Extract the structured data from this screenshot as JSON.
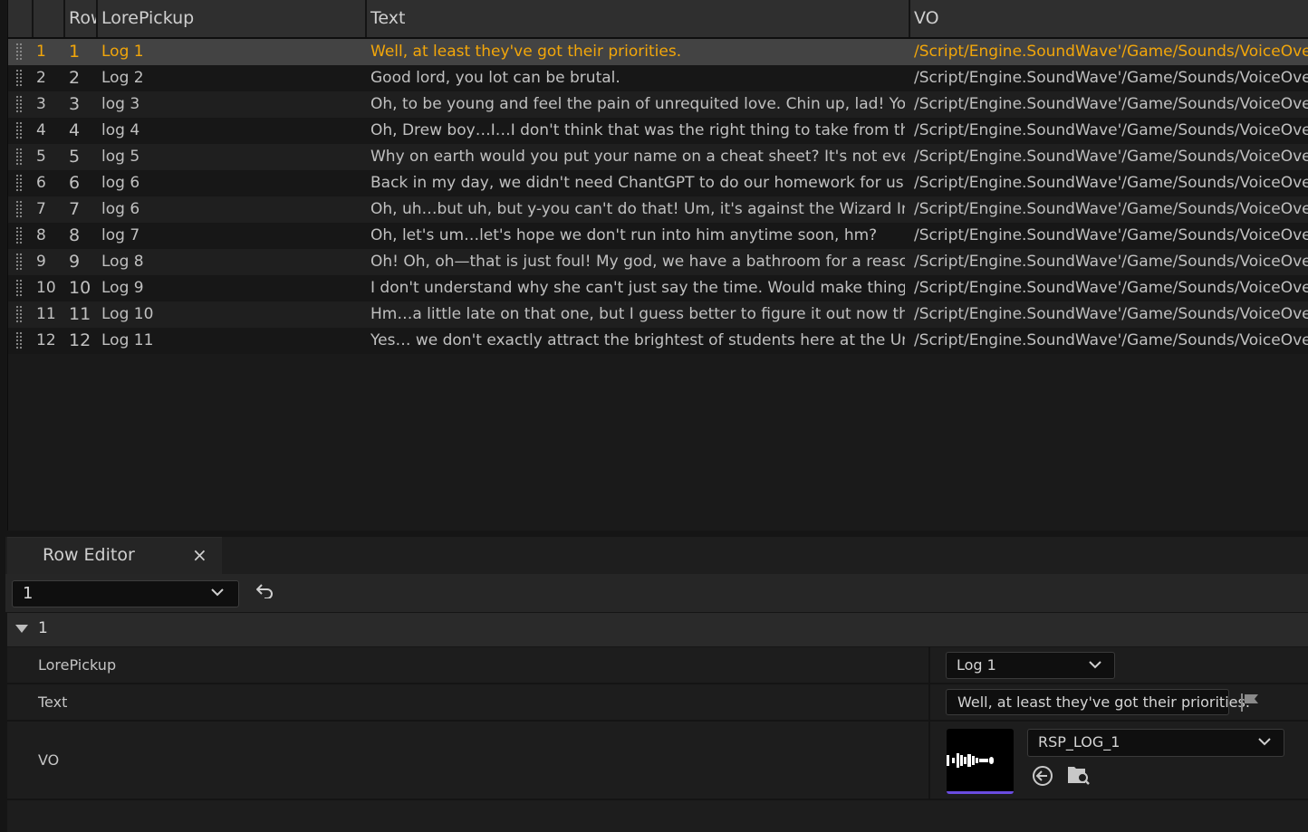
{
  "table": {
    "columns": [
      {
        "label": ""
      },
      {
        "label": "Row Name"
      },
      {
        "label": "LorePickup"
      },
      {
        "label": "Text"
      },
      {
        "label": "VO"
      }
    ],
    "rows": [
      {
        "index": "1",
        "row_name": "1",
        "lore_pickup": "Log 1",
        "text": "Well, at least they've got their priorities.",
        "vo": "/Script/Engine.SoundWave'/Game/Sounds/VoiceOverC"
      },
      {
        "index": "2",
        "row_name": "2",
        "lore_pickup": "Log 2",
        "text": "Good lord, you lot can be brutal.",
        "vo": "/Script/Engine.SoundWave'/Game/Sounds/VoiceOverC"
      },
      {
        "index": "3",
        "row_name": "3",
        "lore_pickup": "log 3",
        "text": "Oh, to be young and feel the pain of unrequited love. Chin up, lad! You'll get",
        "vo": "/Script/Engine.SoundWave'/Game/Sounds/VoiceOverC"
      },
      {
        "index": "4",
        "row_name": "4",
        "lore_pickup": "log 4",
        "text": "Oh, Drew boy…I…I don't think that was the right thing to take from that note",
        "vo": "/Script/Engine.SoundWave'/Game/Sounds/VoiceOverC"
      },
      {
        "index": "5",
        "row_name": "5",
        "lore_pickup": "log 5",
        "text": "Why on earth would you put your name on a cheat sheet? It's not even a go",
        "vo": "/Script/Engine.SoundWave'/Game/Sounds/VoiceOverC"
      },
      {
        "index": "6",
        "row_name": "6",
        "lore_pickup": "log 6",
        "text": "Back in my day, we didn't need ChantGPT to do our homework for us! We'd",
        "vo": "/Script/Engine.SoundWave'/Game/Sounds/VoiceOverC"
      },
      {
        "index": "7",
        "row_name": "7",
        "lore_pickup": "log 6",
        "text": "Oh, uh…but uh, but y-you can't do that! Um, it's against the Wizard Integrity",
        "vo": "/Script/Engine.SoundWave'/Game/Sounds/VoiceOverC"
      },
      {
        "index": "8",
        "row_name": "8",
        "lore_pickup": "log 7",
        "text": "Oh, let's um…let's hope we don't run into him anytime soon, hm?",
        "vo": "/Script/Engine.SoundWave'/Game/Sounds/VoiceOverC"
      },
      {
        "index": "9",
        "row_name": "9",
        "lore_pickup": "Log 8",
        "text": "Oh! Oh, oh—that is just foul! My god, we have a bathroom for a reason!",
        "vo": "/Script/Engine.SoundWave'/Game/Sounds/VoiceOverC"
      },
      {
        "index": "10",
        "row_name": "10",
        "lore_pickup": "Log 9",
        "text": "I don't understand why she can't just say the time. Would make things so m",
        "vo": "/Script/Engine.SoundWave'/Game/Sounds/VoiceOverC"
      },
      {
        "index": "11",
        "row_name": "11",
        "lore_pickup": "Log 10",
        "text": "Hm…a little late on that one, but I guess better to figure it out now than nev",
        "vo": "/Script/Engine.SoundWave'/Game/Sounds/VoiceOverC"
      },
      {
        "index": "12",
        "row_name": "12",
        "lore_pickup": "Log 11",
        "text": "Yes… we don't exactly attract the brightest of students here at the Universit",
        "vo": "/Script/Engine.SoundWave'/Game/Sounds/VoiceOverC"
      }
    ]
  },
  "row_editor": {
    "tab_label": "Row Editor",
    "close_glyph": "×",
    "selected_row": "1",
    "category": "1",
    "properties": {
      "lore_pickup_label": "LorePickup",
      "lore_pickup_value": "Log 1",
      "text_label": "Text",
      "text_value": "Well, at least they've got their priorities.",
      "vo_label": "VO",
      "vo_value": "RSP_LOG_1"
    }
  },
  "colors": {
    "selected_text": "#f2a60a",
    "thumbnail_underline": "#6a4ce0"
  },
  "icons": [
    "grip-handle-icon",
    "chevron-down-icon",
    "undo-icon",
    "triangle-down-icon",
    "flag-icon",
    "sound-wave-icon",
    "use-selected-asset-icon",
    "browse-asset-icon"
  ]
}
